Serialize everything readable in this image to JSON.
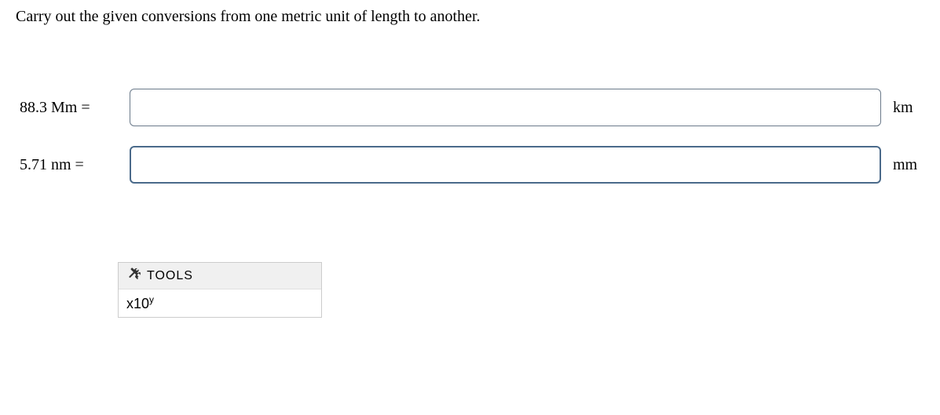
{
  "instruction": "Carry out the given conversions from one metric unit of length to another.",
  "conversions": [
    {
      "label": "88.3 Mm =",
      "value": "",
      "unit": "km"
    },
    {
      "label": "5.71 nm =",
      "value": "",
      "unit": "mm"
    }
  ],
  "tools": {
    "header": "TOOLS",
    "button_base": "x10",
    "button_exp": "y"
  }
}
